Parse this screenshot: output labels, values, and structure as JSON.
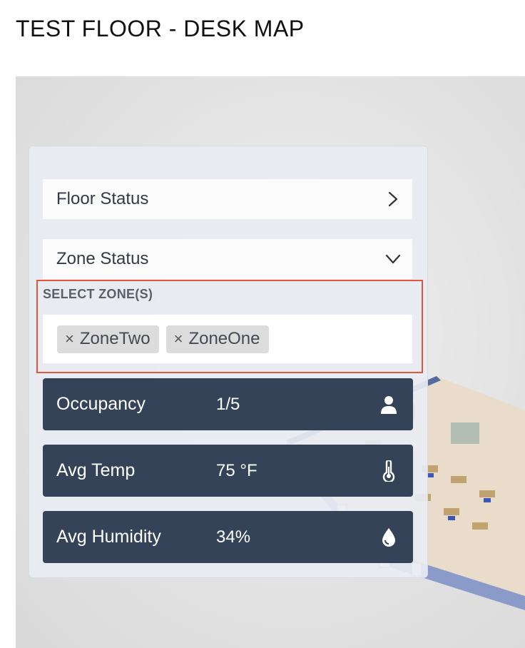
{
  "page": {
    "title": "TEST FLOOR - DESK MAP"
  },
  "panel": {
    "floor_status": {
      "label": "Floor Status",
      "icon": "chevron-right-icon"
    },
    "zone_status": {
      "label": "Zone Status",
      "icon": "chevron-down-icon"
    },
    "zone_select": {
      "label": "SELECT ZONE(S)",
      "selected": [
        {
          "remove_glyph": "×",
          "label": "ZoneTwo"
        },
        {
          "remove_glyph": "×",
          "label": "ZoneOne"
        }
      ]
    },
    "stats": [
      {
        "name": "Occupancy",
        "value": "1/5",
        "icon": "person-icon"
      },
      {
        "name": "Avg Temp",
        "value": "75 °F",
        "icon": "thermometer-icon"
      },
      {
        "name": "Avg Humidity",
        "value": "34%",
        "icon": "water-drop-icon"
      }
    ]
  },
  "colors": {
    "stat_card_bg": "#354358",
    "highlight_border": "#e2573a",
    "chip_bg": "#dcdcdc"
  }
}
